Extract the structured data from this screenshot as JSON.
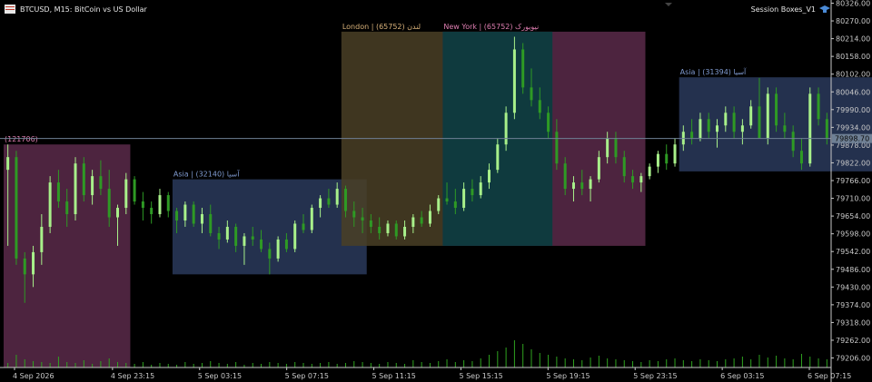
{
  "header": {
    "symbol_line": "BTCUSD, M15:  BitCoin vs US Dollar",
    "indicator_name": "Session Boxes_V1"
  },
  "colors": {
    "background": "#000000",
    "axis": "#c8c8c8",
    "bull_candle": "#a8f08a",
    "bear_candle": "#2e9a24",
    "volume": "#2fa31f",
    "price_line": "#6f8095",
    "asia": "#2a3a5c",
    "london": "#4a4026",
    "newyork": "#5a2a4a",
    "overlap": "#0f3a3e",
    "asia_label": "#7f9ad0",
    "london_label": "#d9b27a",
    "ny_label": "#e07fb2"
  },
  "chart_data": {
    "type": "candlestick",
    "title": "BTCUSD, M15:  BitCoin vs US Dollar",
    "x_tick_labels": [
      "4 Sep 2026",
      "4 Sep 23:15",
      "5 Sep 03:15",
      "5 Sep 07:15",
      "5 Sep 11:15",
      "5 Sep 15:15",
      "5 Sep 19:15",
      "5 Sep 23:15",
      "6 Sep 03:15",
      "6 Sep 07:15"
    ],
    "y_tick_labels": [
      "80326.00",
      "80270.00",
      "80214.00",
      "80158.00",
      "80102.00",
      "80046.00",
      "79990.00",
      "79934.00",
      "79878.00",
      "79822.00",
      "79766.00",
      "79710.00",
      "79654.00",
      "79598.00",
      "79542.00",
      "79486.00",
      "79430.00",
      "79374.00",
      "79318.00",
      "79262.00",
      "79206.00"
    ],
    "ylim": [
      79176,
      80336
    ],
    "current_price": "79898.70",
    "current_price_value": 79898.7,
    "sessions": [
      {
        "name": "newyork",
        "label": "(121706)",
        "x_start_bar": 0,
        "x_end_bar": 14,
        "high": 79880,
        "low": 79176
      },
      {
        "name": "asia",
        "label": "Asia | آسیا  (32140)",
        "x_start_bar": 20,
        "x_end_bar": 42,
        "high": 79770,
        "low": 79470
      },
      {
        "name": "london",
        "label": "London | لندن  (65752)",
        "x_start_bar": 40,
        "x_end_bar": 64,
        "high": 80236,
        "low": 79560
      },
      {
        "name": "newyork",
        "label": "New York | نیویورک  (65752)",
        "x_start_bar": 52,
        "x_end_bar": 75,
        "high": 80236,
        "low": 79560
      },
      {
        "name": "asia",
        "label": "Asia | آسیا  (31394)",
        "x_start_bar": 80,
        "x_end_bar": 103,
        "high": 80092,
        "low": 79795
      }
    ],
    "candles": [
      [
        79800,
        79880,
        79560,
        79840
      ],
      [
        79840,
        79860,
        79500,
        79520
      ],
      [
        79520,
        79540,
        79380,
        79470
      ],
      [
        79470,
        79560,
        79430,
        79540
      ],
      [
        79540,
        79660,
        79500,
        79620
      ],
      [
        79620,
        79780,
        79600,
        79760
      ],
      [
        79760,
        79800,
        79680,
        79700
      ],
      [
        79700,
        79740,
        79620,
        79660
      ],
      [
        79660,
        79840,
        79640,
        79820
      ],
      [
        79820,
        79840,
        79700,
        79720
      ],
      [
        79720,
        79800,
        79690,
        79780
      ],
      [
        79780,
        79830,
        79720,
        79740
      ],
      [
        79740,
        79800,
        79620,
        79650
      ],
      [
        79650,
        79690,
        79560,
        79680
      ],
      [
        79680,
        79790,
        79660,
        79770
      ],
      [
        79770,
        79780,
        79690,
        79700
      ],
      [
        79700,
        79730,
        79640,
        79680
      ],
      [
        79680,
        79700,
        79630,
        79660
      ],
      [
        79660,
        79740,
        79650,
        79720
      ],
      [
        79720,
        79730,
        79650,
        79670
      ],
      [
        79670,
        79680,
        79600,
        79640
      ],
      [
        79640,
        79700,
        79620,
        79690
      ],
      [
        79690,
        79700,
        79620,
        79630
      ],
      [
        79630,
        79680,
        79600,
        79660
      ],
      [
        79660,
        79690,
        79590,
        79600
      ],
      [
        79600,
        79620,
        79550,
        79580
      ],
      [
        79580,
        79640,
        79570,
        79620
      ],
      [
        79620,
        79630,
        79540,
        79560
      ],
      [
        79560,
        79600,
        79500,
        79590
      ],
      [
        79590,
        79620,
        79560,
        79580
      ],
      [
        79580,
        79610,
        79540,
        79550
      ],
      [
        79550,
        79570,
        79470,
        79520
      ],
      [
        79520,
        79590,
        79510,
        79580
      ],
      [
        79580,
        79600,
        79540,
        79550
      ],
      [
        79550,
        79640,
        79540,
        79630
      ],
      [
        79630,
        79660,
        79600,
        79610
      ],
      [
        79610,
        79690,
        79600,
        79680
      ],
      [
        79680,
        79720,
        79650,
        79710
      ],
      [
        79710,
        79740,
        79680,
        79690
      ],
      [
        79690,
        79760,
        79680,
        79740
      ],
      [
        79740,
        79750,
        79650,
        79670
      ],
      [
        79670,
        79700,
        79620,
        79650
      ],
      [
        79650,
        79680,
        79600,
        79640
      ],
      [
        79640,
        79660,
        79600,
        79620
      ],
      [
        79620,
        79650,
        79580,
        79600
      ],
      [
        79600,
        79640,
        79590,
        79630
      ],
      [
        79630,
        79640,
        79580,
        79590
      ],
      [
        79590,
        79640,
        79580,
        79620
      ],
      [
        79620,
        79660,
        79600,
        79650
      ],
      [
        79650,
        79670,
        79620,
        79630
      ],
      [
        79630,
        79690,
        79620,
        79670
      ],
      [
        79670,
        79720,
        79660,
        79710
      ],
      [
        79710,
        79760,
        79690,
        79700
      ],
      [
        79700,
        79740,
        79660,
        79680
      ],
      [
        79680,
        79760,
        79670,
        79740
      ],
      [
        79740,
        79770,
        79700,
        79720
      ],
      [
        79720,
        79780,
        79710,
        79760
      ],
      [
        79760,
        79820,
        79740,
        79800
      ],
      [
        79800,
        79900,
        79790,
        79880
      ],
      [
        79880,
        80000,
        79860,
        79980
      ],
      [
        79980,
        80220,
        79960,
        80180
      ],
      [
        80180,
        80200,
        80040,
        80060
      ],
      [
        80060,
        80120,
        80000,
        80020
      ],
      [
        80020,
        80060,
        79960,
        79980
      ],
      [
        79980,
        80000,
        79900,
        79920
      ],
      [
        79920,
        79960,
        79800,
        79820
      ],
      [
        79820,
        79840,
        79720,
        79740
      ],
      [
        79740,
        79780,
        79700,
        79760
      ],
      [
        79760,
        79800,
        79720,
        79740
      ],
      [
        79740,
        79780,
        79700,
        79770
      ],
      [
        79770,
        79860,
        79760,
        79840
      ],
      [
        79840,
        79920,
        79820,
        79900
      ],
      [
        79900,
        79920,
        79820,
        79840
      ],
      [
        79840,
        79860,
        79760,
        79780
      ],
      [
        79780,
        79800,
        79740,
        79760
      ],
      [
        79760,
        79790,
        79730,
        79780
      ],
      [
        79780,
        79820,
        79770,
        79810
      ],
      [
        79810,
        79860,
        79790,
        79850
      ],
      [
        79850,
        79880,
        79800,
        79820
      ],
      [
        79820,
        79900,
        79810,
        79880
      ],
      [
        79880,
        79940,
        79860,
        79920
      ],
      [
        79920,
        79960,
        79880,
        79900
      ],
      [
        79900,
        79980,
        79890,
        79960
      ],
      [
        79960,
        79980,
        79900,
        79920
      ],
      [
        79920,
        79960,
        79870,
        79940
      ],
      [
        79940,
        80000,
        79920,
        79980
      ],
      [
        79980,
        80000,
        79900,
        79920
      ],
      [
        79920,
        79960,
        79880,
        79940
      ],
      [
        79940,
        80020,
        79930,
        80000
      ],
      [
        80000,
        80090,
        79980,
        79900
      ],
      [
        79900,
        80060,
        79880,
        80040
      ],
      [
        80040,
        80060,
        79920,
        79940
      ],
      [
        79940,
        79980,
        79900,
        79920
      ],
      [
        79920,
        79940,
        79840,
        79860
      ],
      [
        79860,
        79900,
        79800,
        79820
      ],
      [
        79820,
        80060,
        79810,
        80040
      ],
      [
        80040,
        80060,
        79940,
        79960
      ],
      [
        79960,
        79980,
        79880,
        79900
      ]
    ],
    "volumes": [
      5,
      14,
      9,
      7,
      6,
      5,
      12,
      6,
      5,
      8,
      4,
      7,
      10,
      6,
      5,
      4,
      6,
      3,
      5,
      4,
      3,
      6,
      4,
      5,
      7,
      5,
      4,
      6,
      3,
      5,
      4,
      6,
      5,
      4,
      6,
      5,
      4,
      5,
      6,
      4,
      5,
      7,
      6,
      5,
      4,
      6,
      5,
      4,
      8,
      6,
      5,
      7,
      9,
      6,
      8,
      7,
      10,
      14,
      18,
      22,
      30,
      26,
      20,
      16,
      14,
      12,
      10,
      9,
      8,
      11,
      13,
      10,
      9,
      8,
      7,
      6,
      8,
      7,
      9,
      10,
      8,
      7,
      9,
      8,
      7,
      9,
      10,
      12,
      9,
      14,
      11,
      13,
      10,
      9,
      15,
      12,
      10,
      9
    ]
  }
}
